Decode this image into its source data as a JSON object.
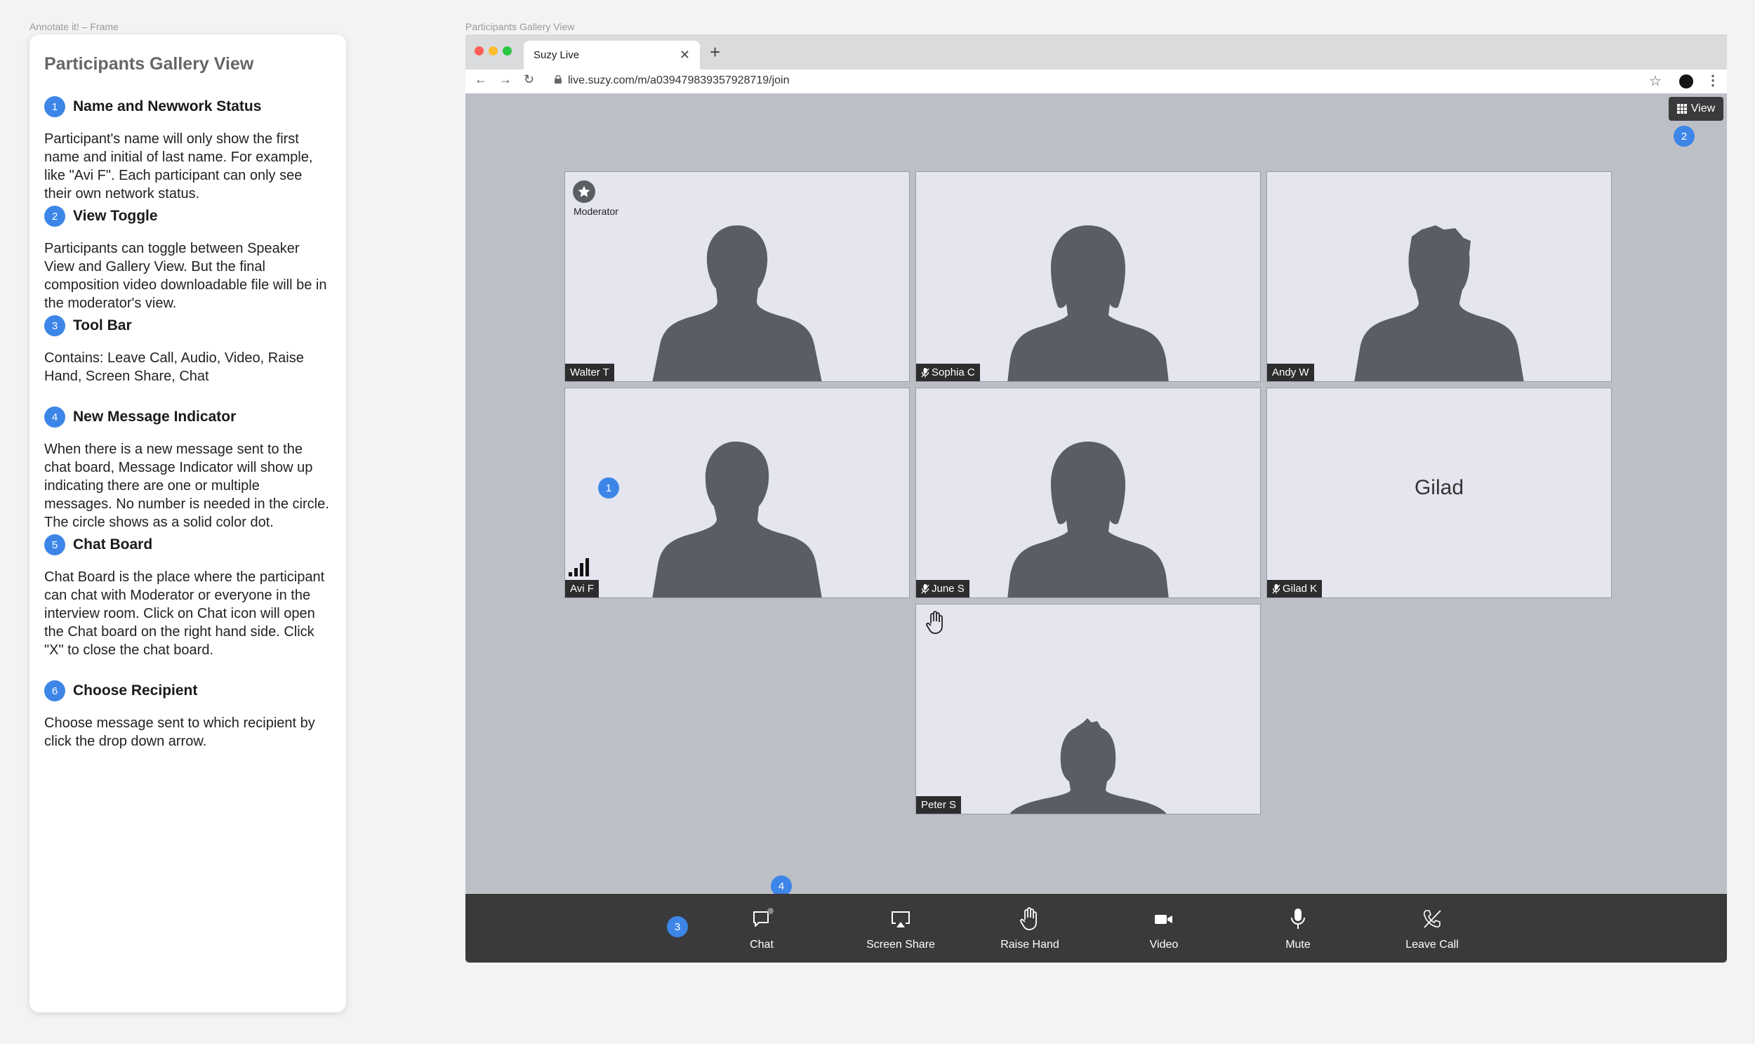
{
  "frames": {
    "left_caption": "Annotate it! – Frame",
    "right_caption": "Participants Gallery View"
  },
  "annotations": {
    "title": "Participants Gallery View",
    "items": [
      {
        "num": "1",
        "title": "Name and Newwork Status",
        "desc": "Participant's name will only show the first name and initial of last name. For example, like \"Avi F\". Each participant can only see their own network status."
      },
      {
        "num": "2",
        "title": "View Toggle",
        "desc": "Participants can toggle between Speaker View and Gallery View. But the final composition video downloadable file will be in the moderator's view."
      },
      {
        "num": "3",
        "title": "Tool Bar",
        "desc": "Contains: Leave Call, Audio, Video, Raise Hand, Screen Share, Chat"
      },
      {
        "num": "4",
        "title": "New Message Indicator",
        "desc": "When there is a new message sent to the chat board, Message Indicator will show up indicating there are one or multiple messages. No number is needed in the circle. The circle shows as a solid color dot."
      },
      {
        "num": "5",
        "title": "Chat Board",
        "desc": "Chat Board is the place where the participant can chat with Moderator or everyone in the interview room. Click on Chat icon will open the Chat board on the right hand side. Click \"X\" to close the chat board."
      },
      {
        "num": "6",
        "title": "Choose Recipient",
        "desc": "Choose message sent to which recipient by click the drop down arrow."
      }
    ]
  },
  "browser": {
    "tab_title": "Suzy Live",
    "tab_close": "✕",
    "new_tab": "+",
    "url": "live.suzy.com/m/a039479839357928719/join",
    "traffic_colors": [
      "#fe5f57",
      "#febc2e",
      "#28c840"
    ]
  },
  "view_toggle": {
    "label": "View",
    "icon": "grid-icon"
  },
  "participants": [
    {
      "name": "Walter T",
      "role": "Moderator",
      "muted": false
    },
    {
      "name": "Sophia C",
      "muted": true
    },
    {
      "name": "Andy W",
      "muted": false
    },
    {
      "name": "Avi F",
      "muted": false,
      "network_status": "strong-signal"
    },
    {
      "name": "June S",
      "muted": true
    },
    {
      "name": "Gilad K",
      "muted": true,
      "display_text": "Gilad",
      "video_off": true
    },
    {
      "name": "Peter S",
      "muted": false,
      "hand_raised": true
    }
  ],
  "toolbar": {
    "buttons": [
      {
        "label": "Chat",
        "icon": "chat-icon",
        "has_new_message": true
      },
      {
        "label": "Screen Share",
        "icon": "screen-share-icon"
      },
      {
        "label": "Raise Hand",
        "icon": "raise-hand-icon"
      },
      {
        "label": "Video",
        "icon": "video-camera-icon"
      },
      {
        "label": "Mute",
        "icon": "microphone-icon"
      },
      {
        "label": "Leave Call",
        "icon": "leave-call-icon"
      }
    ]
  },
  "badges": {
    "one": "1",
    "two": "2",
    "three": "3",
    "four": "4"
  },
  "colors": {
    "accent": "#3d86e8",
    "toolbar_bg": "#3a3a3c",
    "stage_bg": "#bdbfc7",
    "tile_bg": "#e4e5ef"
  }
}
